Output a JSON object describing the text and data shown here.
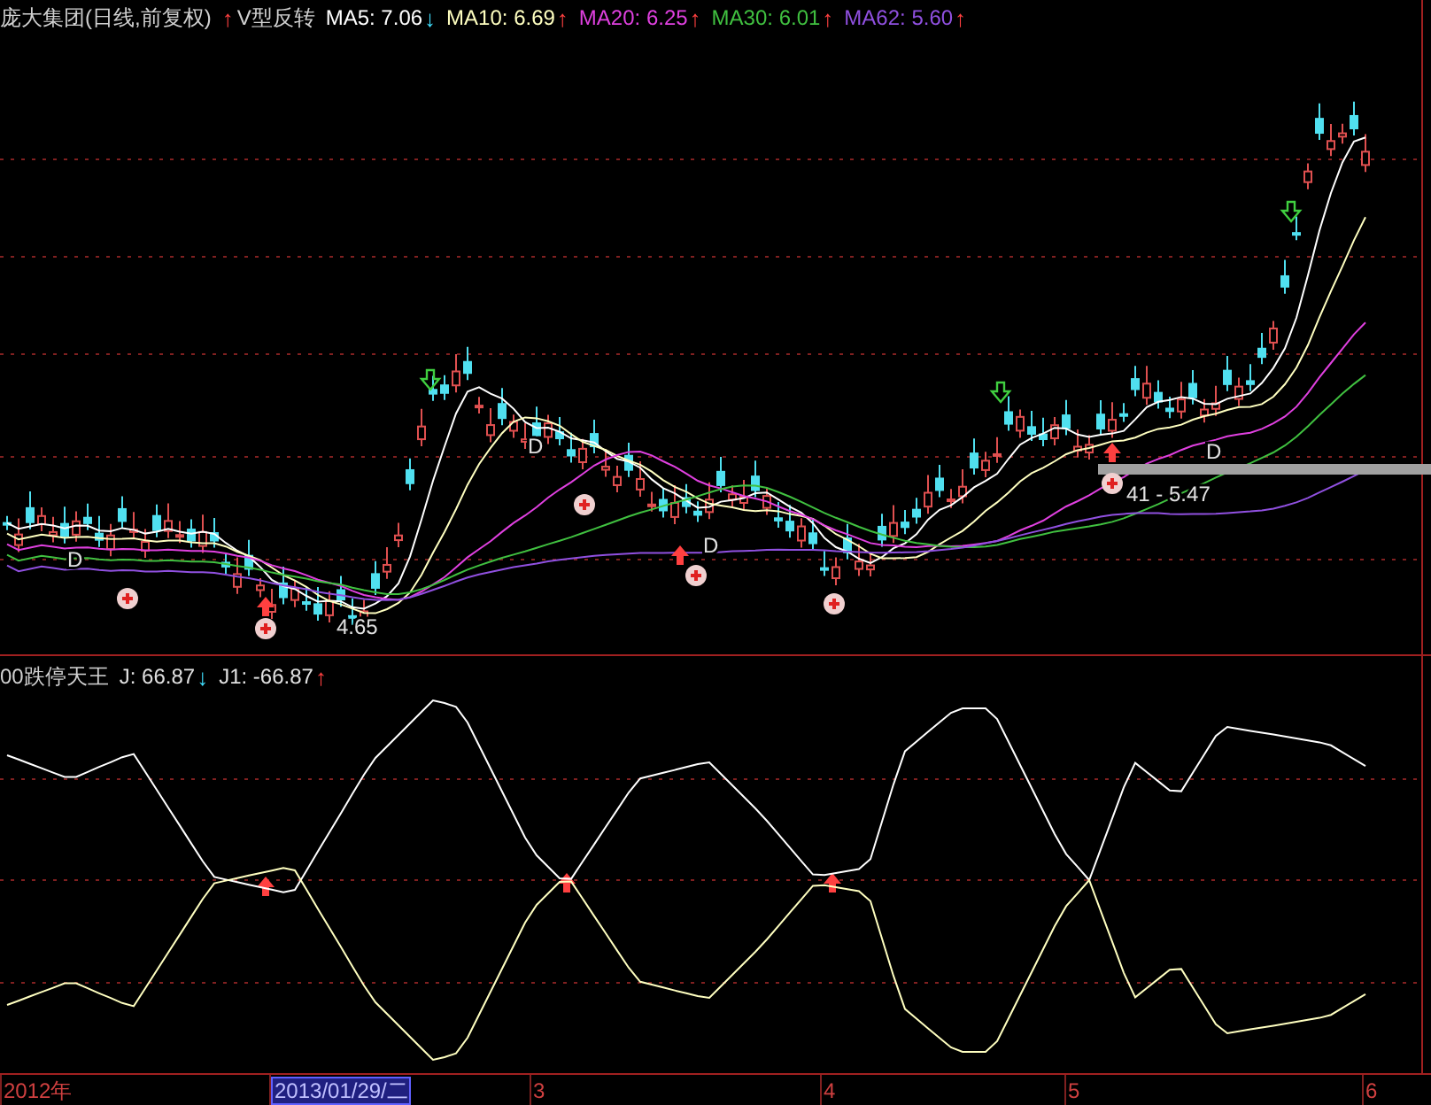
{
  "main_panel": {
    "title": "庞大集团(日线,前复权)",
    "indicator": {
      "label": "V型反转",
      "arrow": "↑",
      "kind": "up"
    },
    "legend": [
      {
        "label": "MA5: 7.06",
        "color": "#ffffff",
        "arrow": "↓",
        "kind": "down"
      },
      {
        "label": "MA10: 6.69",
        "color": "#ffffc0",
        "arrow": "↑",
        "kind": "up"
      },
      {
        "label": "MA20: 6.25",
        "color": "#e040e0",
        "arrow": "↑",
        "kind": "up"
      },
      {
        "label": "MA30: 6.01",
        "color": "#40c040",
        "arrow": "↑",
        "kind": "up"
      },
      {
        "label": "MA62: 5.60",
        "color": "#9050e0",
        "arrow": "↑",
        "kind": "up"
      }
    ],
    "chart_labels": [
      {
        "text": "D"
      },
      {
        "text": "D"
      },
      {
        "text": "D"
      },
      {
        "text": "D"
      },
      {
        "text": "4.65"
      },
      {
        "text": "41 - 5.47"
      }
    ]
  },
  "lower_panel": {
    "title": "00跌停天王",
    "legend": [
      {
        "label": "J: 66.87",
        "arrow": "↓",
        "kind": "down"
      },
      {
        "label": "J1: -66.87",
        "arrow": "↑",
        "kind": "up"
      }
    ]
  },
  "time_axis": [
    {
      "label": "2012年",
      "selected": false
    },
    {
      "label": "2013/01/29/二",
      "selected": true
    },
    {
      "label": "3",
      "selected": false
    },
    {
      "label": "4",
      "selected": false
    },
    {
      "label": "5",
      "selected": false
    },
    {
      "label": "6",
      "selected": false
    }
  ]
}
